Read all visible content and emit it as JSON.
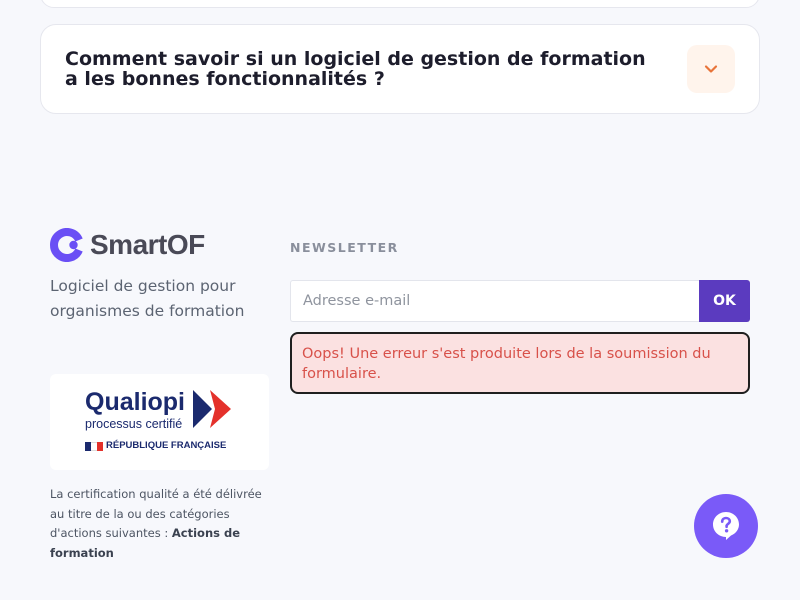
{
  "faq": {
    "question": "Comment savoir si un logiciel de gestion de formation a les bonnes fonctionnalités ?",
    "toggle_icon": "chevron-down-icon",
    "toggle_color": "#e8743a"
  },
  "brand": {
    "name": "SmartOF",
    "tagline": "Logiciel de gestion pour organismes de formation",
    "logo_color": "#6a4ff5"
  },
  "qualiopi": {
    "title": "Qualiopi",
    "subtitle": "processus certifié",
    "republic": "RÉPUBLIQUE FRANÇAISE"
  },
  "certification": {
    "text": "La certification qualité a été délivrée au titre de la ou des catégories d'actions suivantes :",
    "category": "Actions de formation"
  },
  "newsletter": {
    "label": "NEWSLETTER",
    "email_placeholder": "Adresse e-mail",
    "email_value": "",
    "submit_label": "OK",
    "error_message": "Oops! Une erreur s'est produite lors de la soumission du formulaire."
  },
  "help": {
    "icon": "question-bubble-icon",
    "color": "#7a5af8"
  }
}
